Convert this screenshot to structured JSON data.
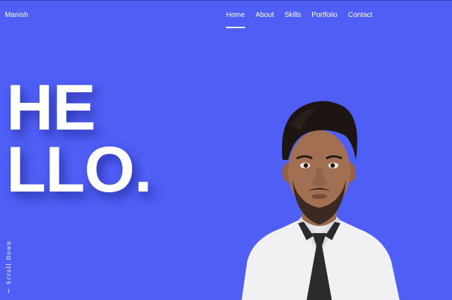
{
  "brand": {
    "name": "Manish"
  },
  "nav": {
    "items": [
      {
        "label": "Home",
        "active": true
      },
      {
        "label": "About",
        "active": false
      },
      {
        "label": "Skills",
        "active": false
      },
      {
        "label": "Portfolio",
        "active": false
      },
      {
        "label": "Contact",
        "active": false
      }
    ]
  },
  "hero": {
    "line1": "HE",
    "line2": "LLO."
  },
  "scroll": {
    "arrow": "←",
    "label": "Scroll Down"
  },
  "portrait": {
    "icon": "person-photo"
  },
  "colors": {
    "background": "#4f5ef5",
    "text": "#ffffff",
    "shirt": "#f2f2f2",
    "tie": "#2b2b2b"
  }
}
